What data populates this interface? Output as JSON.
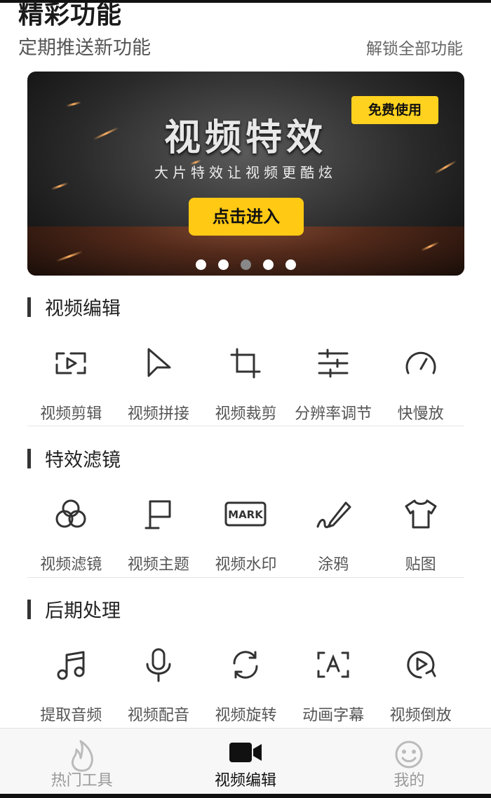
{
  "header": {
    "title": "精彩功能",
    "subtitle": "定期推送新功能",
    "unlock_all": "解锁全部功能"
  },
  "banner": {
    "headline": "视频特效",
    "subline": "大片特效让视频更酷炫",
    "badge": "免费使用",
    "cta": "点击进入",
    "dots_total": 5,
    "active_dot": 3
  },
  "sections": [
    {
      "title": "视频编辑",
      "tools": [
        {
          "label": "视频剪辑",
          "icon": "video-clip-icon"
        },
        {
          "label": "视频拼接",
          "icon": "cursor-play-icon"
        },
        {
          "label": "视频裁剪",
          "icon": "crop-icon"
        },
        {
          "label": "分辨率调节",
          "icon": "sliders-icon"
        },
        {
          "label": "快慢放",
          "icon": "speedometer-icon"
        }
      ]
    },
    {
      "title": "特效滤镜",
      "tools": [
        {
          "label": "视频滤镜",
          "icon": "filter-circles-icon"
        },
        {
          "label": "视频主题",
          "icon": "flag-icon"
        },
        {
          "label": "视频水印",
          "icon": "watermark-icon"
        },
        {
          "label": "涂鸦",
          "icon": "pen-scribble-icon"
        },
        {
          "label": "贴图",
          "icon": "tshirt-icon"
        }
      ]
    },
    {
      "title": "后期处理",
      "tools": [
        {
          "label": "提取音频",
          "icon": "music-note-icon"
        },
        {
          "label": "视频配音",
          "icon": "microphone-icon"
        },
        {
          "label": "视频旋转",
          "icon": "rotate-icon"
        },
        {
          "label": "动画字幕",
          "icon": "subtitle-icon"
        },
        {
          "label": "视频倒放",
          "icon": "reverse-play-icon"
        }
      ]
    }
  ],
  "tabs": [
    {
      "label": "热门工具",
      "icon": "flame-icon",
      "active": false
    },
    {
      "label": "视频编辑",
      "icon": "video-camera-icon",
      "active": true
    },
    {
      "label": "我的",
      "icon": "smiley-icon",
      "active": false
    }
  ],
  "colors": {
    "accent_yellow": "#ffc914",
    "text_dark": "#222222"
  }
}
